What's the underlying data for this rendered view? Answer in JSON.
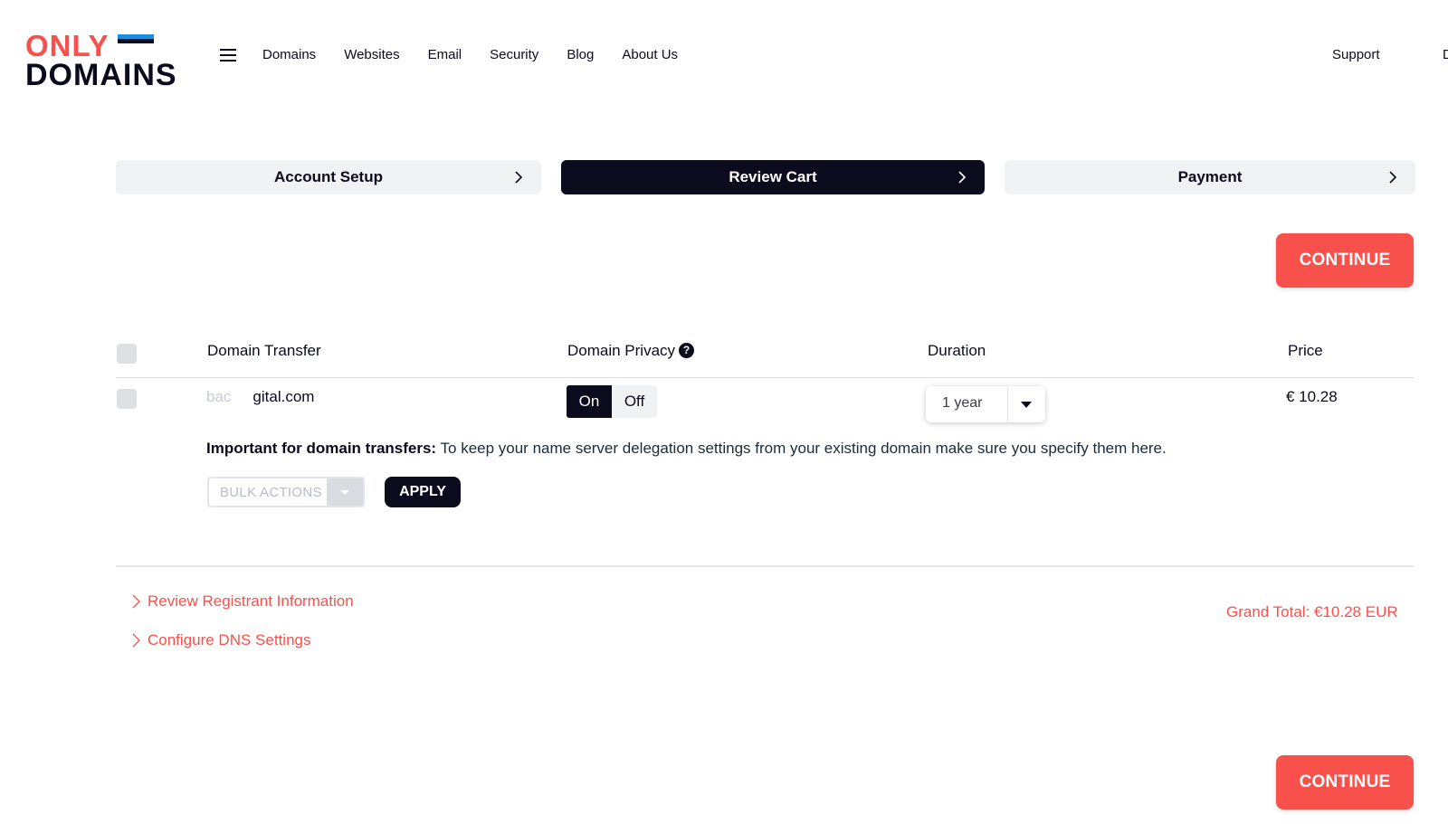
{
  "brand": {
    "line1": "ONLY",
    "line2": "DOMAINS",
    "flag_colors": [
      "#1f8de0",
      "#0b0b1e",
      "#ffffff"
    ]
  },
  "nav": {
    "menu_icon": "hamburger-icon",
    "items": [
      "Domains",
      "Websites",
      "Email",
      "Security",
      "Blog",
      "About Us"
    ],
    "support": "Support",
    "edge_text": "D"
  },
  "steps": [
    {
      "label": "Account Setup",
      "active": false
    },
    {
      "label": "Review Cart",
      "active": true
    },
    {
      "label": "Payment",
      "active": false
    }
  ],
  "continue_label": "CONTINUE",
  "table": {
    "headers": {
      "domain": "Domain Transfer",
      "privacy": "Domain Privacy",
      "privacy_help": "?",
      "duration": "Duration",
      "price": "Price"
    },
    "row": {
      "domain_hidden": "bac",
      "domain_visible": "gital.com",
      "privacy_on": "On",
      "privacy_off": "Off",
      "privacy_state": "On",
      "duration": "1 year",
      "price": "€ 10.28"
    }
  },
  "note": {
    "bold": "Important for domain transfers:",
    "text": " To keep your name server delegation settings from your existing domain make sure you specify them here."
  },
  "bulk": {
    "placeholder": "BULK ACTIONS",
    "apply": "APPLY"
  },
  "links": [
    "Review Registrant Information",
    "Configure DNS Settings"
  ],
  "grand_total": "Grand Total: €10.28 EUR",
  "colors": {
    "accent": "#f8514c",
    "dark": "#0b0b1e"
  }
}
